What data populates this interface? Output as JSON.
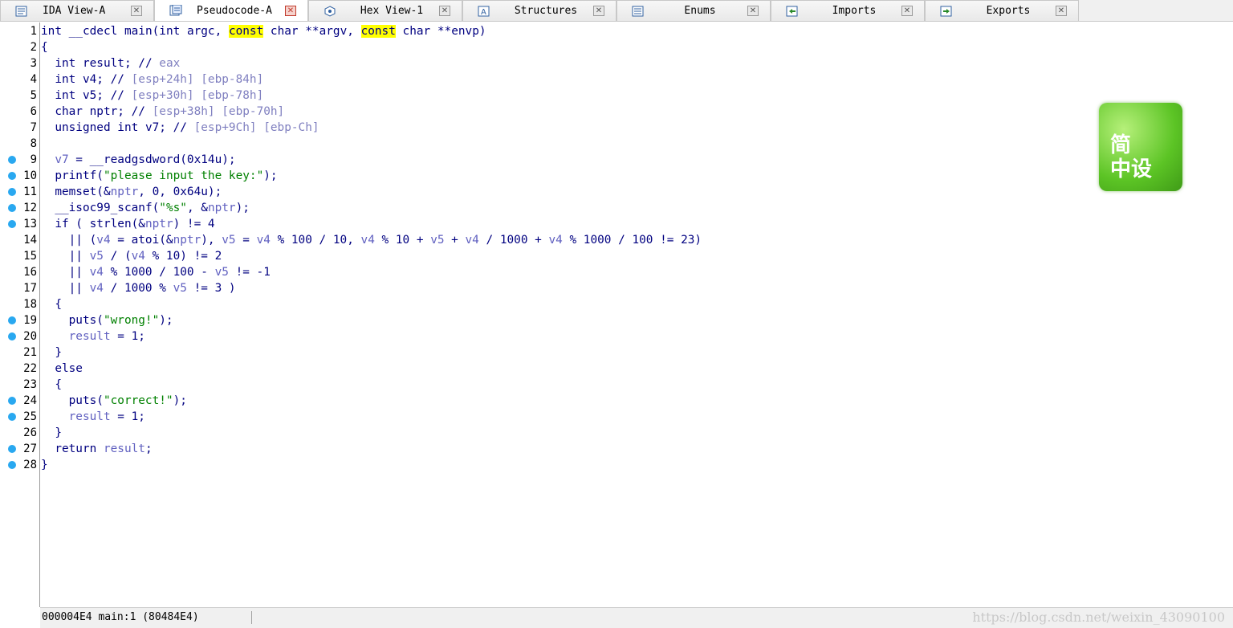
{
  "tabs": [
    {
      "label": "IDA View-A",
      "icon": "disassembly-view-icon",
      "active": false
    },
    {
      "label": "Pseudocode-A",
      "icon": "pseudocode-icon",
      "active": true
    },
    {
      "label": "Hex View-1",
      "icon": "hex-view-icon",
      "active": false
    },
    {
      "label": "Structures",
      "icon": "structures-icon",
      "active": false
    },
    {
      "label": "Enums",
      "icon": "enums-icon",
      "active": false
    },
    {
      "label": "Imports",
      "icon": "imports-icon",
      "active": false
    },
    {
      "label": "Exports",
      "icon": "exports-icon",
      "active": false
    }
  ],
  "tab_close_glyph": "✕",
  "code_lines": [
    {
      "n": "1",
      "bp": false,
      "indent": 0,
      "tokens": [
        [
          "kw",
          "int __cdecl main(int argc, "
        ],
        [
          "hl",
          "const"
        ],
        [
          "kw",
          " char **argv, "
        ],
        [
          "hl",
          "const"
        ],
        [
          "kw",
          " char **envp)"
        ]
      ]
    },
    {
      "n": "2",
      "bp": false,
      "indent": 0,
      "tokens": [
        [
          "kw",
          "{"
        ]
      ]
    },
    {
      "n": "3",
      "bp": false,
      "indent": 2,
      "tokens": [
        [
          "kw",
          "int result; // "
        ],
        [
          "cm",
          "eax"
        ]
      ]
    },
    {
      "n": "4",
      "bp": false,
      "indent": 2,
      "tokens": [
        [
          "kw",
          "int v4; // "
        ],
        [
          "cm",
          "[esp+24h] [ebp-84h]"
        ]
      ]
    },
    {
      "n": "5",
      "bp": false,
      "indent": 2,
      "tokens": [
        [
          "kw",
          "int v5; // "
        ],
        [
          "cm",
          "[esp+30h] [ebp-78h]"
        ]
      ]
    },
    {
      "n": "6",
      "bp": false,
      "indent": 2,
      "tokens": [
        [
          "kw",
          "char nptr; // "
        ],
        [
          "cm",
          "[esp+38h] [ebp-70h]"
        ]
      ]
    },
    {
      "n": "7",
      "bp": false,
      "indent": 2,
      "tokens": [
        [
          "kw",
          "unsigned int v7; // "
        ],
        [
          "cm",
          "[esp+9Ch] [ebp-Ch]"
        ]
      ]
    },
    {
      "n": "8",
      "bp": false,
      "indent": 0,
      "tokens": []
    },
    {
      "n": "9",
      "bp": true,
      "indent": 2,
      "tokens": [
        [
          "var",
          "v7"
        ],
        [
          "kw",
          " = __readgsdword(0x14u);"
        ]
      ]
    },
    {
      "n": "10",
      "bp": true,
      "indent": 2,
      "tokens": [
        [
          "kw",
          "printf("
        ],
        [
          "str",
          "\"please input the key:\""
        ],
        [
          "kw",
          ");"
        ]
      ]
    },
    {
      "n": "11",
      "bp": true,
      "indent": 2,
      "tokens": [
        [
          "kw",
          "memset(&"
        ],
        [
          "var",
          "nptr"
        ],
        [
          "kw",
          ", 0, 0x64u);"
        ]
      ]
    },
    {
      "n": "12",
      "bp": true,
      "indent": 2,
      "tokens": [
        [
          "kw",
          "__isoc99_scanf("
        ],
        [
          "str",
          "\"%s\""
        ],
        [
          "kw",
          ", &"
        ],
        [
          "var",
          "nptr"
        ],
        [
          "kw",
          ");"
        ]
      ]
    },
    {
      "n": "13",
      "bp": true,
      "indent": 2,
      "tokens": [
        [
          "kw",
          "if ( strlen(&"
        ],
        [
          "var",
          "nptr"
        ],
        [
          "kw",
          ") != 4"
        ]
      ]
    },
    {
      "n": "14",
      "bp": false,
      "indent": 4,
      "tokens": [
        [
          "kw",
          "|| ("
        ],
        [
          "var",
          "v4"
        ],
        [
          "kw",
          " = atoi(&"
        ],
        [
          "var",
          "nptr"
        ],
        [
          "kw",
          "), "
        ],
        [
          "var",
          "v5"
        ],
        [
          "kw",
          " = "
        ],
        [
          "var",
          "v4"
        ],
        [
          "kw",
          " % 100 / 10, "
        ],
        [
          "var",
          "v4"
        ],
        [
          "kw",
          " % 10 + "
        ],
        [
          "var",
          "v5"
        ],
        [
          "kw",
          " + "
        ],
        [
          "var",
          "v4"
        ],
        [
          "kw",
          " / 1000 + "
        ],
        [
          "var",
          "v4"
        ],
        [
          "kw",
          " % 1000 / 100 != 23)"
        ]
      ]
    },
    {
      "n": "15",
      "bp": false,
      "indent": 4,
      "tokens": [
        [
          "kw",
          "|| "
        ],
        [
          "var",
          "v5"
        ],
        [
          "kw",
          " / ("
        ],
        [
          "var",
          "v4"
        ],
        [
          "kw",
          " % 10) != 2"
        ]
      ]
    },
    {
      "n": "16",
      "bp": false,
      "indent": 4,
      "tokens": [
        [
          "kw",
          "|| "
        ],
        [
          "var",
          "v4"
        ],
        [
          "kw",
          " % 1000 / 100 - "
        ],
        [
          "var",
          "v5"
        ],
        [
          "kw",
          " != -1"
        ]
      ]
    },
    {
      "n": "17",
      "bp": false,
      "indent": 4,
      "tokens": [
        [
          "kw",
          "|| "
        ],
        [
          "var",
          "v4"
        ],
        [
          "kw",
          " / 1000 % "
        ],
        [
          "var",
          "v5"
        ],
        [
          "kw",
          " != 3 )"
        ]
      ]
    },
    {
      "n": "18",
      "bp": false,
      "indent": 2,
      "tokens": [
        [
          "kw",
          "{"
        ]
      ]
    },
    {
      "n": "19",
      "bp": true,
      "indent": 4,
      "tokens": [
        [
          "kw",
          "puts("
        ],
        [
          "str",
          "\"wrong!\""
        ],
        [
          "kw",
          ");"
        ]
      ]
    },
    {
      "n": "20",
      "bp": true,
      "indent": 4,
      "tokens": [
        [
          "var",
          "result"
        ],
        [
          "kw",
          " = 1;"
        ]
      ]
    },
    {
      "n": "21",
      "bp": false,
      "indent": 2,
      "tokens": [
        [
          "kw",
          "}"
        ]
      ]
    },
    {
      "n": "22",
      "bp": false,
      "indent": 2,
      "tokens": [
        [
          "kw",
          "else"
        ]
      ]
    },
    {
      "n": "23",
      "bp": false,
      "indent": 2,
      "tokens": [
        [
          "kw",
          "{"
        ]
      ]
    },
    {
      "n": "24",
      "bp": true,
      "indent": 4,
      "tokens": [
        [
          "kw",
          "puts("
        ],
        [
          "str",
          "\"correct!\""
        ],
        [
          "kw",
          ");"
        ]
      ]
    },
    {
      "n": "25",
      "bp": true,
      "indent": 4,
      "tokens": [
        [
          "var",
          "result"
        ],
        [
          "kw",
          " = 1;"
        ]
      ]
    },
    {
      "n": "26",
      "bp": false,
      "indent": 2,
      "tokens": [
        [
          "kw",
          "}"
        ]
      ]
    },
    {
      "n": "27",
      "bp": true,
      "indent": 2,
      "tokens": [
        [
          "kw",
          "return "
        ],
        [
          "var",
          "result"
        ],
        [
          "kw",
          ";"
        ]
      ]
    },
    {
      "n": "28",
      "bp": true,
      "indent": 0,
      "tokens": [
        [
          "kw",
          "}"
        ]
      ]
    }
  ],
  "logo": {
    "line1": "简",
    "line2": "中设"
  },
  "status": {
    "text": "000004E4 main:1 (80484E4)"
  },
  "watermark": "https://blog.csdn.net/weixin_43090100",
  "colors": {
    "breakpoint": "#29a8f0",
    "keyword": "#000080",
    "variable": "#6060c0",
    "comment": "#8080c0",
    "string": "#008000",
    "highlight": "#ffff00"
  }
}
